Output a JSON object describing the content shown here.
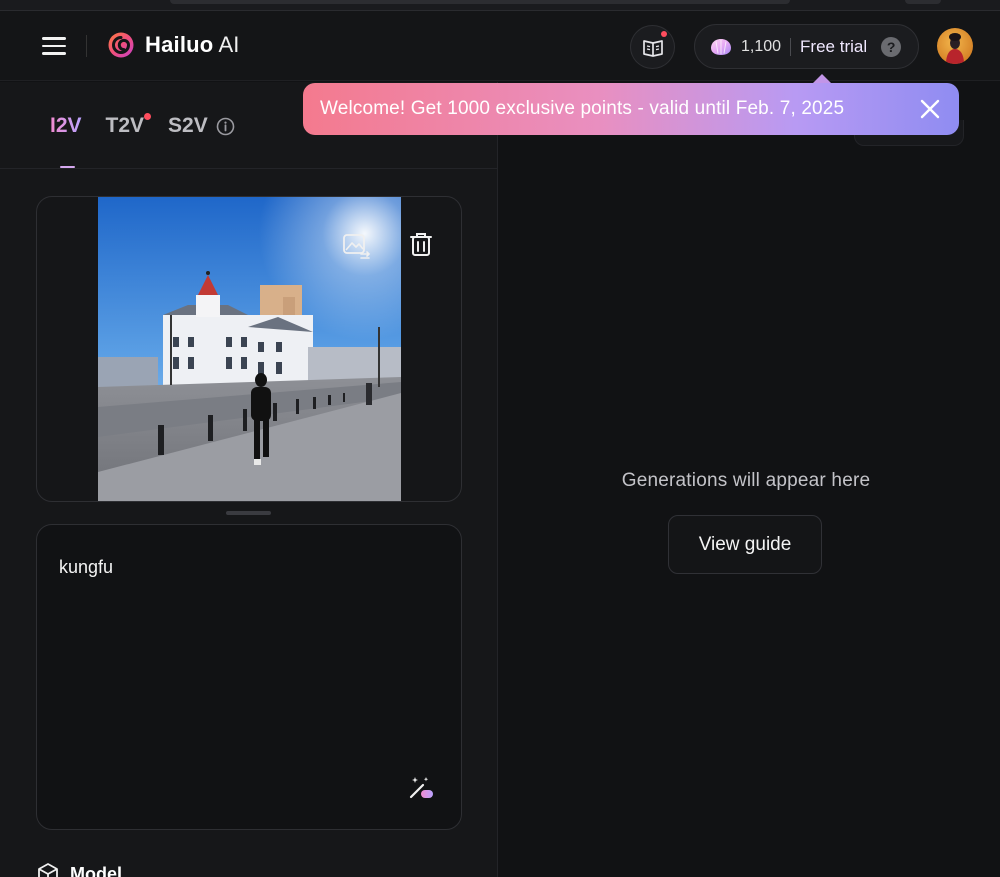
{
  "header": {
    "brand": "Hailuo",
    "brand_suffix": "AI",
    "points": "1,100",
    "plan": "Free trial",
    "help": "?"
  },
  "toast": {
    "message": "Welcome! Get 1000 exclusive points - valid until Feb. 7, 2025"
  },
  "tabs": [
    {
      "label": "I2V",
      "active": true
    },
    {
      "label": "T2V",
      "badge": true
    },
    {
      "label": "S2V",
      "info": true
    }
  ],
  "prompt": {
    "value": "kungfu"
  },
  "model": {
    "label": "Model"
  },
  "output": {
    "empty_text": "Generations will appear here",
    "view_guide_label": "View guide"
  },
  "icons": {
    "menu": "hamburger-menu-icon",
    "logo": "hailuo-logo-icon",
    "guide": "book-icon",
    "points": "shell-gem-icon",
    "close": "close-icon",
    "replace": "replace-image-icon",
    "delete": "trash-icon",
    "enhance": "magic-wand-icon",
    "model": "cube-icon",
    "info": "info-icon"
  },
  "colors": {
    "background": "#111214",
    "panel": "#161719",
    "accent_pink": "#f28bd0",
    "accent_violet": "#b9a3ff",
    "badge_red": "#ff4d5e"
  }
}
